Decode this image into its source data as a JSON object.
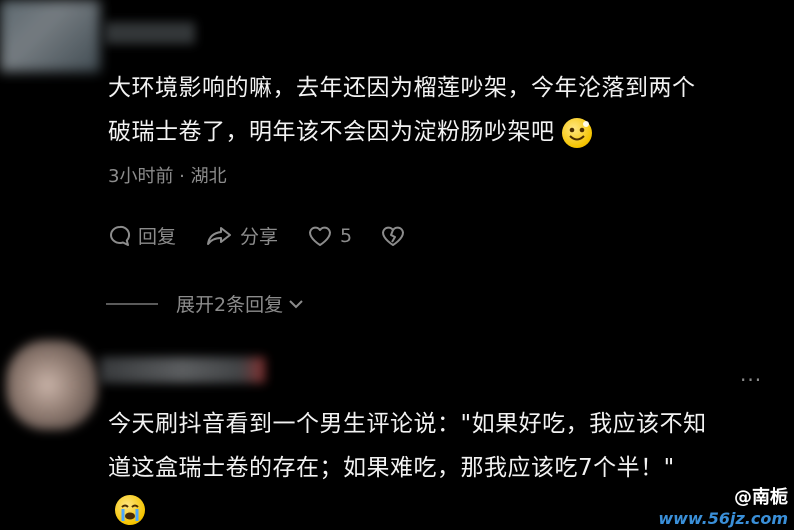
{
  "comment1": {
    "line1": "大环境影响的嘛，去年还因为榴莲吵架，今年沦落到两个",
    "line2": "破瑞士卷了，明年该不会因为淀粉肠吵架吧",
    "emoji": "grin-emoji",
    "meta": "3小时前 · 湖北",
    "reply_label": "回复",
    "share_label": "分享",
    "like_count": "5"
  },
  "expand_replies": "展开2条回复",
  "comment2": {
    "more": "···",
    "line1": "今天刷抖音看到一个男生评论说：\"如果好吃，我应该不知",
    "line2": "道这盒瑞士卷的存在；如果难吃，那我应该吃7个半！\"",
    "emoji": "crying-emoji"
  },
  "watermark": {
    "brand": "@南栀",
    "url": "www.56jz.com"
  }
}
